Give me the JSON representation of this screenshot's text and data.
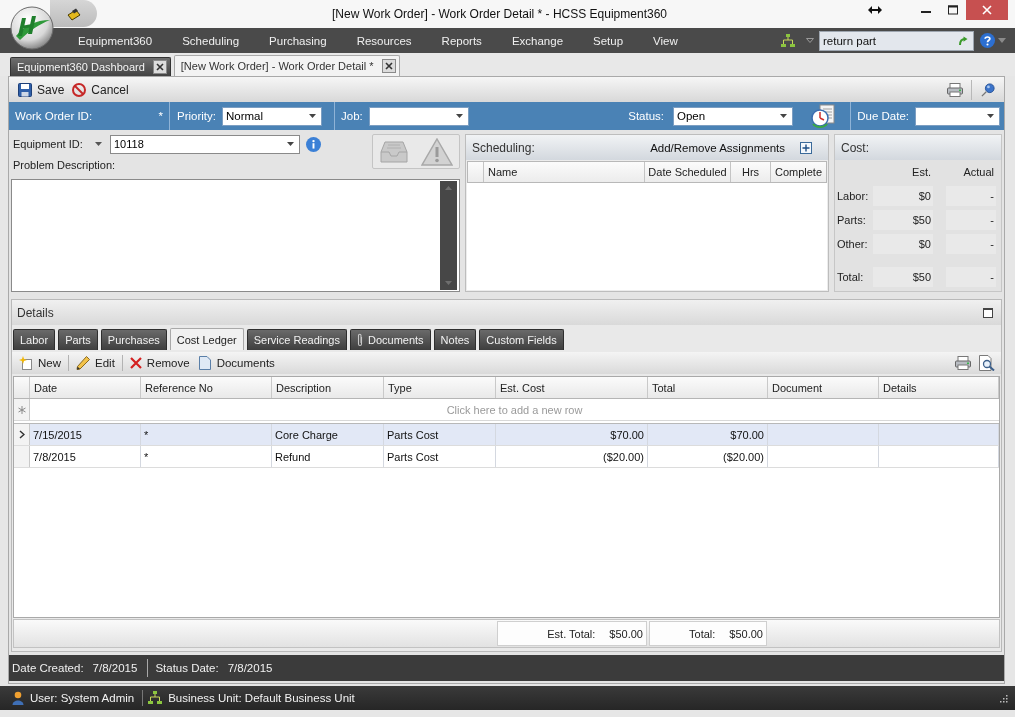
{
  "window": {
    "title": "[New Work Order] - Work Order Detail * - HCSS Equipment360"
  },
  "menu": {
    "items": [
      "Equipment360",
      "Scheduling",
      "Purchasing",
      "Resources",
      "Reports",
      "Exchange",
      "Setup",
      "View"
    ],
    "search": {
      "value": "return part"
    }
  },
  "document_tabs": [
    {
      "label": "Equipment360 Dashboard",
      "selected": false
    },
    {
      "label": "[New Work Order] - Work Order Detail *",
      "selected": true
    }
  ],
  "toolbar": [
    {
      "label": "Save",
      "kind": "save"
    },
    {
      "label": "Cancel",
      "kind": "cancel"
    }
  ],
  "header": {
    "work_order_id": {
      "label": "Work Order ID:",
      "marker": "*"
    },
    "priority": {
      "label": "Priority:",
      "value": "Normal"
    },
    "job": {
      "label": "Job:"
    },
    "status": {
      "label": "Status:",
      "value": "Open"
    },
    "due_date": {
      "label": "Due Date:"
    }
  },
  "equipment": {
    "label": "Equipment ID:",
    "value": "10118"
  },
  "problem_description": {
    "label": "Problem Description:"
  },
  "scheduling": {
    "title": "Scheduling:",
    "action": "Add/Remove Assignments",
    "columns": [
      "Name",
      "Date Scheduled",
      "Hrs",
      "Complete"
    ]
  },
  "cost": {
    "title": "Cost:",
    "columns": [
      "Est.",
      "Actual"
    ],
    "rows": [
      {
        "label": "Labor:",
        "est": "$0",
        "actual": "-",
        "kind": "line"
      },
      {
        "label": "Parts:",
        "est": "$50",
        "actual": "-",
        "kind": "line"
      },
      {
        "label": "Other:",
        "est": "$0",
        "actual": "-",
        "kind": "line"
      },
      {
        "label": "Total:",
        "est": "$50",
        "actual": "-",
        "kind": "total"
      }
    ]
  },
  "details": {
    "title": "Details",
    "tabs": [
      {
        "label": "Labor",
        "selected": false,
        "kind": "plain"
      },
      {
        "label": "Parts",
        "selected": false,
        "kind": "plain"
      },
      {
        "label": "Purchases",
        "selected": false,
        "kind": "plain"
      },
      {
        "label": "Cost Ledger",
        "selected": true,
        "kind": "plain"
      },
      {
        "label": "Service Readings",
        "selected": false,
        "kind": "plain"
      },
      {
        "label": "Documents",
        "selected": false,
        "kind": "attachment"
      },
      {
        "label": "Notes",
        "selected": false,
        "kind": "plain"
      },
      {
        "label": "Custom Fields",
        "selected": false,
        "kind": "plain"
      }
    ],
    "toolbar": [
      {
        "label": "New",
        "kind": "new"
      },
      {
        "label": "Edit",
        "kind": "edit"
      },
      {
        "label": "Remove",
        "kind": "remove"
      },
      {
        "label": "Documents",
        "kind": "documents"
      }
    ],
    "grid": {
      "columns": [
        "Date",
        "Reference No",
        "Description",
        "Type",
        "Est. Cost",
        "Total",
        "Document",
        "Details"
      ],
      "new_row_hint": "Click here to add a new row",
      "rows": [
        {
          "selected": true,
          "cells": [
            "7/15/2015",
            "*",
            "Core Charge",
            "Parts Cost",
            "$70.00",
            "$70.00"
          ]
        },
        {
          "selected": false,
          "cells": [
            "7/8/2015",
            "*",
            "Refund",
            "Parts Cost",
            "($20.00)",
            "($20.00)"
          ]
        }
      ],
      "totals": [
        {
          "label": "Est. Total:",
          "value": "$50.00"
        },
        {
          "label": "Total:",
          "value": "$50.00"
        }
      ]
    }
  },
  "dates": [
    {
      "label": "Date Created:",
      "value": "7/8/2015"
    },
    {
      "label": "Status Date:",
      "value": "7/8/2015"
    }
  ],
  "status_bar": {
    "user": "User: System Admin",
    "business_unit": "Business Unit: Default Business Unit"
  }
}
